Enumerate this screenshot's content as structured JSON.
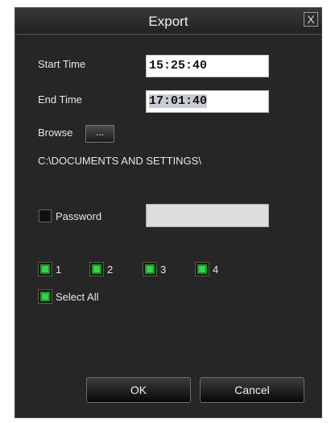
{
  "dialog": {
    "title": "Export",
    "close_symbol": "X"
  },
  "start_time": {
    "label": "Start Time",
    "value": "15:25:40"
  },
  "end_time": {
    "label": "End Time",
    "value": "17:01:40"
  },
  "browse": {
    "label": "Browse",
    "button_label": "..."
  },
  "path": "C:\\DOCUMENTS AND SETTINGS\\",
  "password": {
    "label": "Password",
    "checked": false,
    "value": ""
  },
  "channels": [
    {
      "label": "1",
      "checked": true
    },
    {
      "label": "2",
      "checked": true
    },
    {
      "label": "3",
      "checked": true
    },
    {
      "label": "4",
      "checked": true
    }
  ],
  "select_all": {
    "label": "Select All",
    "checked": true
  },
  "buttons": {
    "ok": "OK",
    "cancel": "Cancel"
  },
  "colors": {
    "dialog_bg": "#262626",
    "checkbox_green": "#2fd63f"
  }
}
